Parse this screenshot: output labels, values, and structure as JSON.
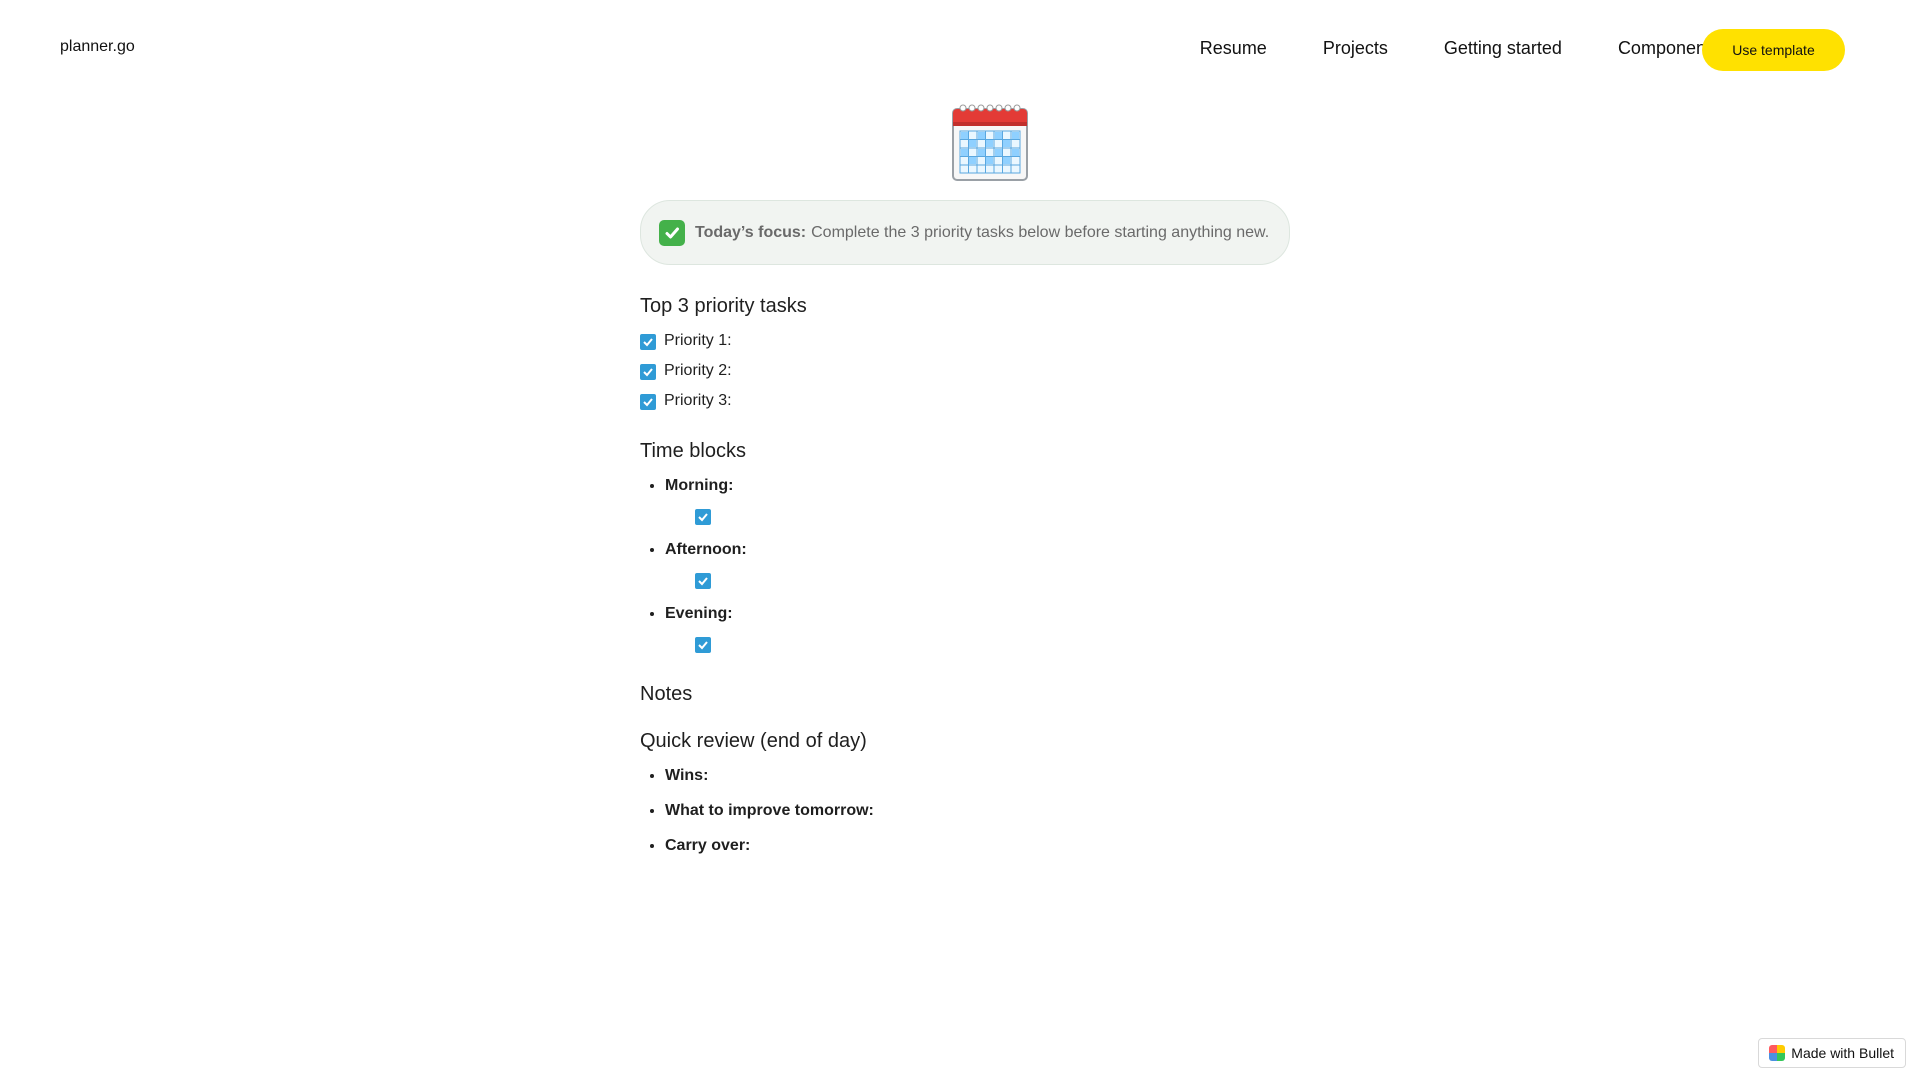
{
  "header": {
    "brand": "planner.go",
    "nav": [
      "Resume",
      "Projects",
      "Getting started",
      "Components"
    ],
    "cta": "Use template"
  },
  "hero": {
    "icon": "calendar-icon"
  },
  "callout": {
    "icon": "check-mark-button-icon",
    "label": "Today’s focus:",
    "text": "Complete the 3 priority tasks below before starting anything new."
  },
  "sections": {
    "priorities": {
      "title": "Top 3 priority tasks",
      "items": [
        "Priority 1:",
        "Priority 2:",
        "Priority 3:"
      ]
    },
    "timeblocks": {
      "title": "Time blocks",
      "items": [
        "Morning:",
        "Afternoon:",
        "Evening:"
      ]
    },
    "notes": {
      "title": "Notes"
    },
    "review": {
      "title": "Quick review (end of day)",
      "items": [
        "Wins:",
        "What to improve tomorrow:",
        "Carry over:"
      ]
    }
  },
  "footer": {
    "badge": "Made with Bullet"
  },
  "colors": {
    "accent_yellow": "#ffe100",
    "checkbox_blue": "#2f9bd6",
    "callout_bg": "#f1f4f1",
    "callout_check_green": "#44b14a"
  }
}
